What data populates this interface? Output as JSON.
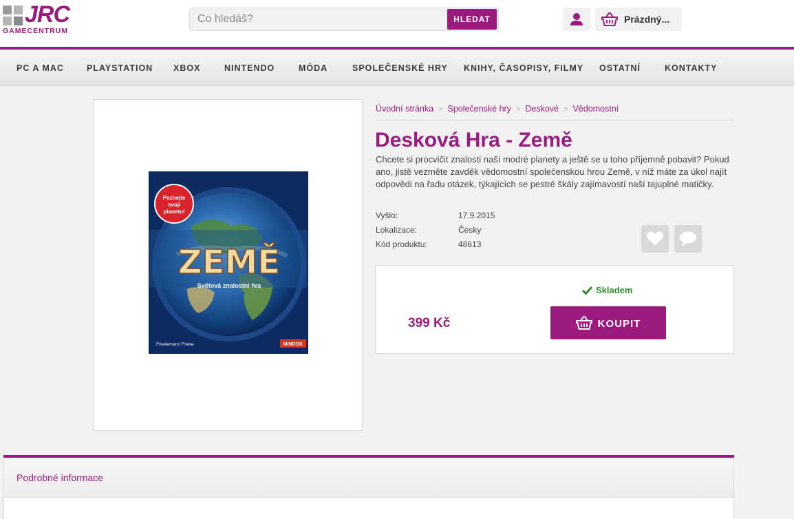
{
  "brand": {
    "logo_text": "JRC",
    "logo_sub": "GAMECENTRUM",
    "accent_color": "#9b1a7e"
  },
  "search": {
    "placeholder": "Co hledáš?",
    "button_label": "HLEDAT"
  },
  "header": {
    "user_icon": "user-icon",
    "cart_icon": "basket-icon",
    "cart_label": "Prázdný..."
  },
  "nav": {
    "items": [
      {
        "label": "PC A MAC"
      },
      {
        "label": "PLAYSTATION"
      },
      {
        "label": "XBOX"
      },
      {
        "label": "NINTENDO"
      },
      {
        "label": "MÓDA"
      },
      {
        "label": "SPOLEČENSKÉ HRY"
      },
      {
        "label": "KNIHY, ČASOPISY, FILMY"
      },
      {
        "label": "OSTATNÍ"
      },
      {
        "label": "KONTAKTY"
      }
    ]
  },
  "breadcrumb": {
    "items": [
      {
        "label": "Úvodní stránka"
      },
      {
        "label": "Společenské hry"
      },
      {
        "label": "Deskové"
      },
      {
        "label": "Vědomostní"
      }
    ],
    "separator": ">"
  },
  "product": {
    "title": "Desková Hra - Země",
    "description": "Chcete si procvičit znalosti naší modré planety a ještě se u toho příjemně pobavit? Pokud ano, jistě vezměte zavděk vědomostní společenskou hrou Země, v níž máte za úkol najít odpovědi na řadu otázek, týkajících se pestré škály zajímavostí naší tajuplné matičky.",
    "props": [
      {
        "label": "Vyšlo:",
        "value": "17.9.2015"
      },
      {
        "label": "Lokalizace:",
        "value": "Česky"
      },
      {
        "label": "Kód produktu:",
        "value": "48613"
      }
    ],
    "box_art": {
      "badge": "Poznejte svoji planetu!",
      "title": "ZEMĚ",
      "subtitle": "Světová znalostní hra",
      "author": "Friedemann Friese",
      "publisher": "MINDOK"
    },
    "stock": "Skladem",
    "price": "399 Kč",
    "buy_label": "KOUPIT"
  },
  "details": {
    "tab_label": "Podrobné informace"
  }
}
